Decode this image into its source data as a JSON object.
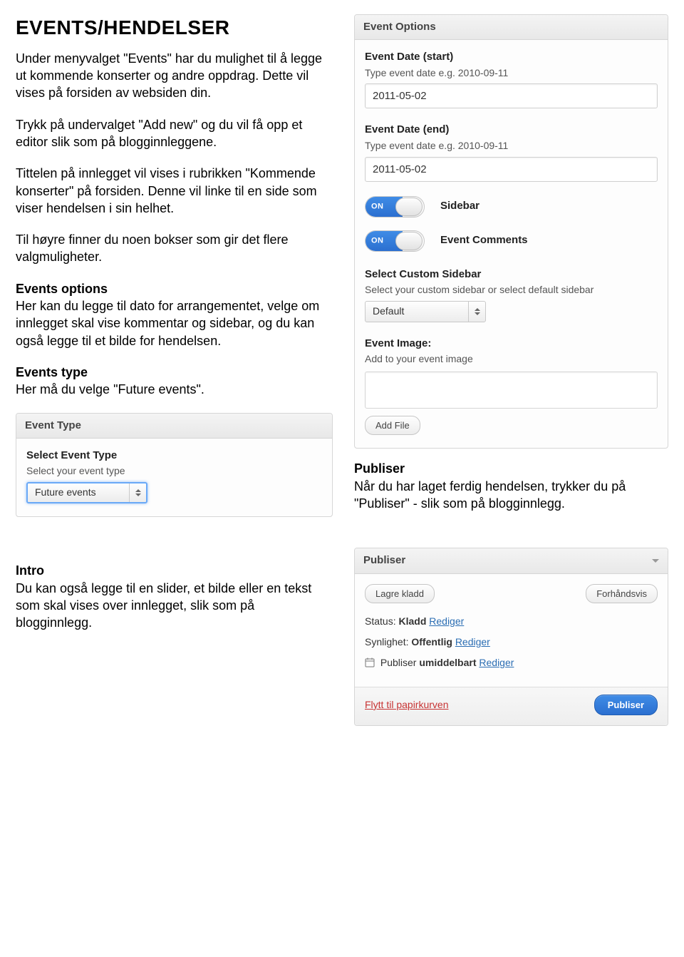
{
  "doc": {
    "heading": "EVENTS/HENDELSER",
    "p1": "Under menyvalget \"Events\" har du mulighet til å legge ut kommende konserter og andre oppdrag. Dette vil vises på forsiden av websiden din.",
    "p2": "Trykk på undervalget \"Add new\" og du vil få opp et editor slik som på blogginnleggene.",
    "p3": "Tittelen på innlegget vil vises i rubrikken \"Kommende konserter\" på forsiden. Denne vil linke til en side som viser hendelsen i sin helhet.",
    "p4": "Til høyre finner du noen bokser som gir det flere valgmuligheter.",
    "opt_h": "Events options",
    "opt_b": "Her kan du legge til dato for arrangementet, velge om innlegget skal vise kommentar og sidebar, og du kan også legge til et bilde for hendelsen.",
    "type_h": "Events type",
    "type_b": "Her må du velge \"Future events\".",
    "pub_h": "Publiser",
    "pub_b": "Når du har laget ferdig hendelsen, trykker du på \"Publiser\" - slik som på blogginnlegg.",
    "intro_h": "Intro",
    "intro_b": "Du kan også legge til en slider, et bilde eller en tekst som skal vises over innlegget, slik som på blogginnlegg."
  },
  "event_options": {
    "title": "Event Options",
    "start_label": "Event Date (start)",
    "start_help": "Type event date e.g. 2010-09-11",
    "start_value": "2011-05-02",
    "end_label": "Event Date (end)",
    "end_help": "Type event date e.g. 2010-09-11",
    "end_value": "2011-05-02",
    "toggle_on": "ON",
    "sidebar_label": "Sidebar",
    "comments_label": "Event Comments",
    "custom_sidebar_label": "Select Custom Sidebar",
    "custom_sidebar_help": "Select your custom sidebar or select default sidebar",
    "custom_sidebar_value": "Default",
    "image_label": "Event Image:",
    "image_help": "Add to your event image",
    "add_file": "Add File"
  },
  "event_type": {
    "title": "Event Type",
    "select_label": "Select Event Type",
    "select_help": "Select your event type",
    "select_value": "Future events"
  },
  "publish": {
    "title": "Publiser",
    "draft_btn": "Lagre kladd",
    "preview_btn": "Forhåndsvis",
    "status_label": "Status:",
    "status_value": "Kladd",
    "vis_label": "Synlighet:",
    "vis_value": "Offentlig",
    "schedule_text": "Publiser",
    "schedule_bold": "umiddelbart",
    "edit_link": "Rediger",
    "trash": "Flytt til papirkurven",
    "publish_btn": "Publiser"
  }
}
